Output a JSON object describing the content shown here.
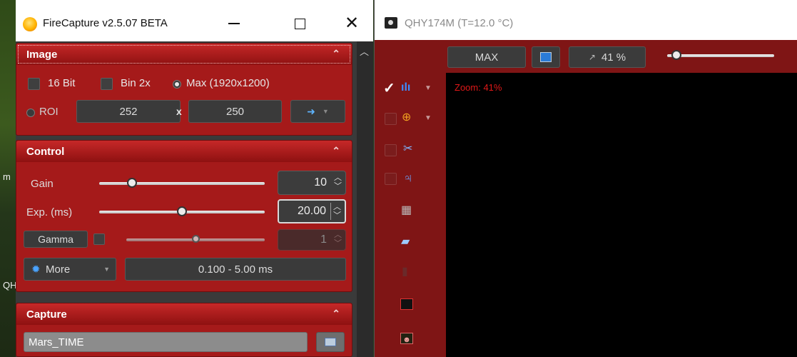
{
  "firecapture": {
    "title": "FireCapture v2.5.07 BETA",
    "image_panel": {
      "header": "Image",
      "bit16_label": "16 Bit",
      "bin2x_label": "Bin 2x",
      "max_label": "Max (1920x1200)",
      "roi_label": "ROI",
      "roi_width": "252",
      "roi_x": "x",
      "roi_height": "250"
    },
    "control_panel": {
      "header": "Control",
      "gain_label": "Gain",
      "gain_value": "10",
      "gain_level": 0.2,
      "exp_label": "Exp. (ms)",
      "exp_value": "20.00",
      "exp_level": 0.5,
      "gamma_label": "Gamma",
      "gamma_value": "1",
      "gamma_level": 0.5,
      "more_label": "More",
      "range_text": "0.100 - 5.00 ms"
    },
    "capture_panel": {
      "header": "Capture",
      "filename": "Mars_TIME"
    }
  },
  "camera": {
    "title": "QHY174M (T=12.0 °C)",
    "max_btn": "MAX",
    "zoom_btn": "41 %",
    "zoom_overlay": "Zoom: 41%"
  },
  "colors": {
    "panel_red": "#a51a1a",
    "camera_bg": "#8c1a1a",
    "zoom_text": "#e01818"
  }
}
